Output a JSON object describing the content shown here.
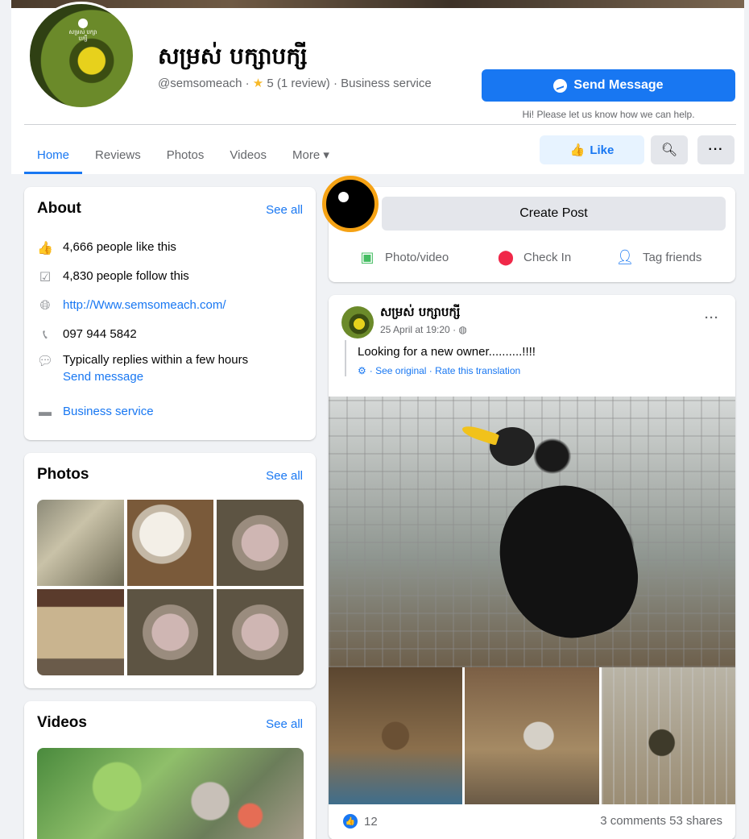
{
  "page": {
    "name": "សម្រស់ បក្សាបក្សី",
    "handle": "@semsomeach",
    "rating": "5",
    "reviews": "(1 review)",
    "category": "Business service",
    "send_message_label": "Send Message",
    "send_message_hint": "Hi! Please let us know how we can help.",
    "avatar_text": "សម្រស់ បក្សាបក្សី"
  },
  "tabs": [
    {
      "label": "Home"
    },
    {
      "label": "Reviews"
    },
    {
      "label": "Photos"
    },
    {
      "label": "Videos"
    },
    {
      "label": "More ▾"
    }
  ],
  "actions": {
    "like_label": "Like",
    "search_icon": "search-icon",
    "more_icon": "more-icon"
  },
  "about": {
    "title": "About",
    "see_all": "See all",
    "likes": "4,666 people like this",
    "follows": "4,830 people follow this",
    "website": "http://Www.semsomeach.com/",
    "phone": "097 944 5842",
    "replies": "Typically replies within a few hours",
    "send_message": "Send message",
    "category": "Business service"
  },
  "photos": {
    "title": "Photos",
    "see_all": "See all"
  },
  "videos": {
    "title": "Videos",
    "see_all": "See all"
  },
  "create_post": {
    "label": "Create Post",
    "photo_video": "Photo/video",
    "check_in": "Check In",
    "tag_friends": "Tag friends"
  },
  "post": {
    "author": "សម្រស់ បក្សាបក្សី",
    "time": "25 April at 19:20 · ◍",
    "text": "Looking for a new owner..........!!!!",
    "translate": "· See original · Rate this translation",
    "likes": "12",
    "comments_shares": "3 comments 53 shares"
  },
  "colors": {
    "brand_blue": "#1877f2",
    "background": "#f0f2f5"
  }
}
